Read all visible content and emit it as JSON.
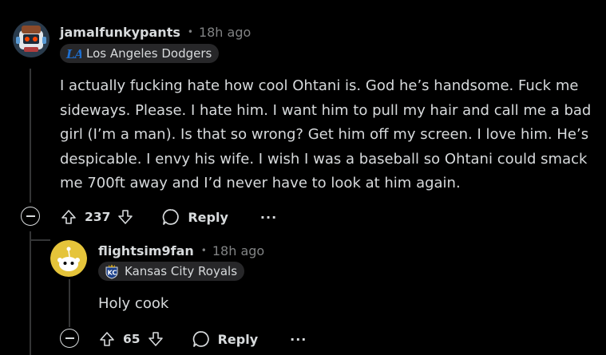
{
  "comment": {
    "username": "jamalfunkypants",
    "time": "18h ago",
    "flair": "Los Angeles Dodgers",
    "text": "I actually fucking hate how cool Ohtani is. God he’s handsome. Fuck me sideways. Please. I hate him. I want him to pull my hair and call me a bad girl (I’m a man). Is that so wrong? Get him off my screen. I love him. He’s despicable. I envy his wife. I wish I was a baseball so Ohtani could smack me 700ft away and I’d never have to look at him again.",
    "score": "237",
    "reply_label": "Reply",
    "more_label": "···",
    "avatar_icon": "snoo-robot-avatar-icon",
    "flair_icon": "dodgers-logo-icon"
  },
  "reply": {
    "username": "flightsim9fan",
    "time": "18h ago",
    "flair": "Kansas City Royals",
    "text": "Holy cook",
    "score": "65",
    "reply_label": "Reply",
    "more_label": "···",
    "avatar_icon": "snoo-default-avatar-icon",
    "flair_icon": "royals-logo-icon"
  },
  "separator": "•",
  "colors": {
    "background": "#000000",
    "text": "#d7dadc",
    "muted": "#818384",
    "flair_bg": "#272729",
    "thread_line": "#343536",
    "avatar_yellow": "#e5c43a"
  }
}
